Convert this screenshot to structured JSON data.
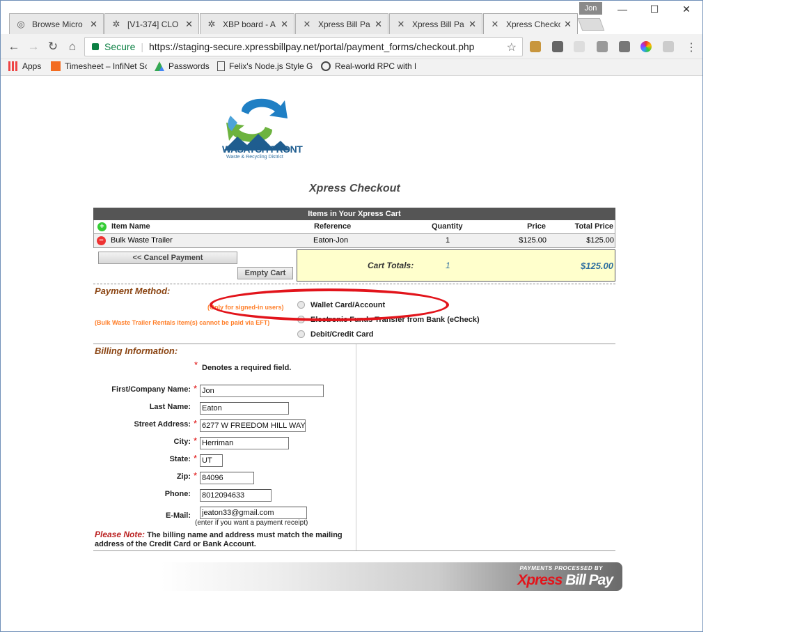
{
  "browser": {
    "tabs": [
      {
        "label": "Browse Micro",
        "icon": "clock-icon"
      },
      {
        "label": "[V1-374] CLO",
        "icon": "jira-icon"
      },
      {
        "label": "XBP board - A",
        "icon": "jira-icon"
      },
      {
        "label": "Xpress Bill Pa",
        "icon": "xbp-icon"
      },
      {
        "label": "Xpress Bill Pa",
        "icon": "xbp-icon"
      },
      {
        "label": "Xpress Checko",
        "icon": "xbp-icon"
      }
    ],
    "user": "Jon",
    "secure_label": "Secure",
    "url": "https://staging-secure.xpressbillpay.net/portal/payment_forms/checkout.php",
    "bookmarks": [
      "Apps",
      "Timesheet – InfiNet Sc",
      "Passwords",
      "Felix's Node.js Style G",
      "Real-world RPC with F"
    ]
  },
  "logo": {
    "title": "WASATCH FRONT",
    "subtitle": "Waste & Recycling District"
  },
  "page_title": "Xpress Checkout",
  "cart": {
    "header": "Items in Your Xpress Cart",
    "columns": {
      "name": "Item Name",
      "reference": "Reference",
      "quantity": "Quantity",
      "price": "Price",
      "total": "Total Price"
    },
    "item": {
      "name": "Bulk Waste Trailer",
      "reference": "Eaton-Jon",
      "quantity": "1",
      "price": "$125.00",
      "total": "$125.00"
    },
    "cancel_label": "<< Cancel Payment",
    "empty_label": "Empty Cart",
    "totals_label": "Cart Totals:",
    "totals_qty": "1",
    "totals_amount": "$125.00"
  },
  "payment": {
    "heading": "Payment Method:",
    "note_signed_in": "(Only for signed-in users)",
    "note_eft": "(Bulk Waste Trailer Rentals item(s) cannot be paid via EFT)",
    "options": [
      "Wallet Card/Account",
      "Electronic Funds Transfer from Bank (eCheck)",
      "Debit/Credit Card"
    ]
  },
  "billing": {
    "heading": "Billing Information:",
    "required_note": "Denotes a required field.",
    "labels": {
      "first": "First/Company Name:",
      "last": "Last Name:",
      "street": "Street Address:",
      "city": "City:",
      "state": "State:",
      "zip": "Zip:",
      "phone": "Phone:",
      "email": "E-Mail:"
    },
    "values": {
      "first": "Jon",
      "last": "Eaton",
      "street": "6277 W FREEDOM HILL WAY",
      "city": "Herriman",
      "state": "UT",
      "zip": "84096",
      "phone": "8012094633",
      "email": "jeaton33@gmail.com"
    },
    "email_hint": "(enter if you want a payment receipt)",
    "please_note": "Please Note:",
    "note_text": "The billing name and address must match the mailing address of the Credit Card or Bank Account."
  },
  "footer": {
    "processed_by": "PAYMENTS PROCESSED BY",
    "brand_x": "Xpress",
    "brand_rest": "Bill Pay"
  },
  "colors": {
    "accent_red": "#e2141b",
    "section_brown": "#8b4513",
    "totals_bg": "#ffffcc",
    "secure_green": "#0b8043"
  }
}
